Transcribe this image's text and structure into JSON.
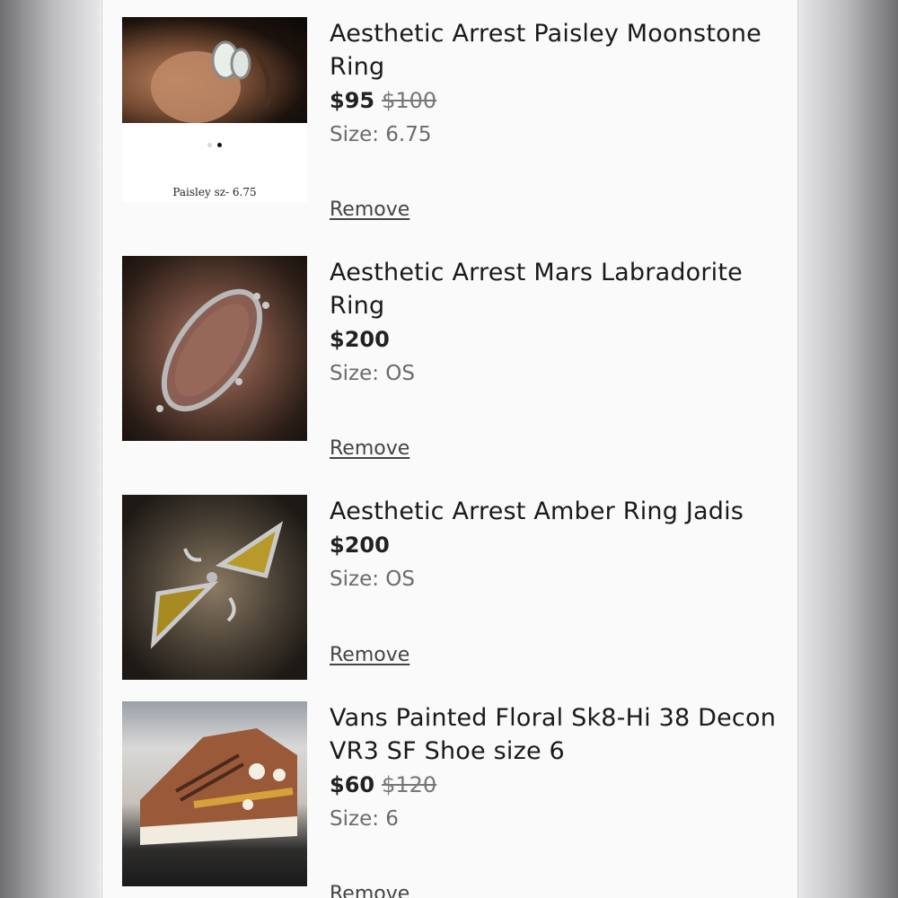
{
  "cart": {
    "remove_label": "Remove",
    "items": [
      {
        "title": "Aesthetic Arrest Paisley Moonstone Ring",
        "price": "$95",
        "original_price": "$100",
        "size": "Size: 6.75",
        "image_caption": "Paisley sz- 6.75"
      },
      {
        "title": "Aesthetic Arrest Mars Labradorite Ring",
        "price": "$200",
        "original_price": "",
        "size": "Size: OS"
      },
      {
        "title": "Aesthetic Arrest Amber Ring Jadis",
        "price": "$200",
        "original_price": "",
        "size": "Size: OS"
      },
      {
        "title": "Vans Painted Floral Sk8-Hi 38 Decon VR3 SF Shoe size 6",
        "price": "$60",
        "original_price": "$120",
        "size": "Size: 6"
      }
    ]
  }
}
